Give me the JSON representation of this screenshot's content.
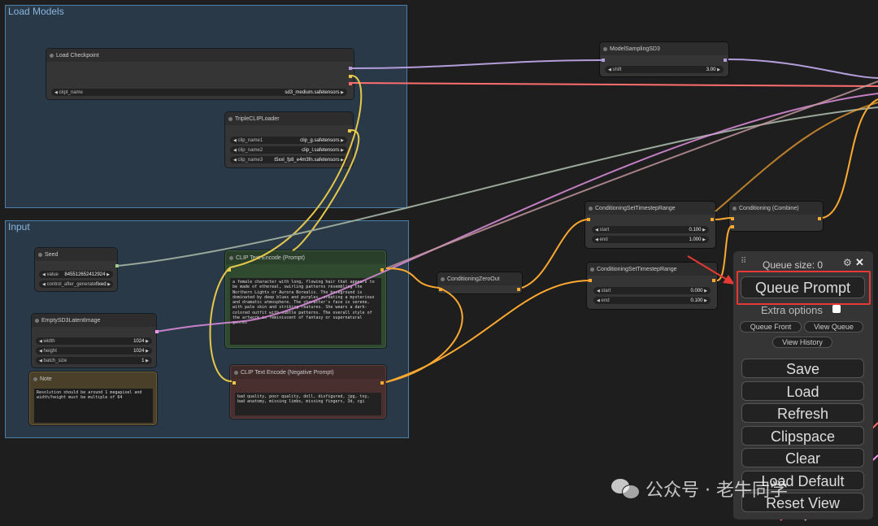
{
  "groups": {
    "load_models": "Load Models",
    "input": "Input"
  },
  "load_checkpoint": {
    "title": "Load Checkpoint",
    "ckpt_label": "ckpt_name",
    "ckpt_value": "sd3_medium.safetensors"
  },
  "model_sampling": {
    "title": "ModelSamplingSD3",
    "shift_label": "shift",
    "shift_value": "3.00"
  },
  "triple_clip": {
    "title": "TripleCLIPLoader",
    "clip1_label": "clip_name1",
    "clip1_value": "clip_g.safetensors",
    "clip2_label": "clip_name2",
    "clip2_value": "clip_l.safetensors",
    "clip3_label": "clip_name3",
    "clip3_value": "t5xxl_fp8_e4m3fn.safetensors"
  },
  "seed": {
    "title": "Seed",
    "value_label": "value",
    "value": "845512652412924",
    "control_label": "control_after_generate",
    "control_value": "fixed"
  },
  "latent": {
    "title": "EmptySD3LatentImage",
    "width_label": "width",
    "width_value": "1024",
    "height_label": "height",
    "height_value": "1024",
    "batch_label": "batch_size",
    "batch_value": "1"
  },
  "note": {
    "title": "Note",
    "text": "Resolution should be around 1 megapixel and width/height must be multiple of 64"
  },
  "clip_pos": {
    "title": "CLIP Text Encode (Prompt)",
    "text": "a female character with long, flowing hair that appears to be made of ethereal, swirling patterns resembling the Northern Lights or Aurora Borealis. The background is dominated by deep blues and purples, creating a mysterious and dramatic atmosphere. The character's face is serene, with pale skin and striking features. She wears a dark-colored outfit with subtle patterns. The overall style of the artwork is reminiscent of fantasy or supernatural genres"
  },
  "clip_neg": {
    "title": "CLIP Text Encode (Negative Prompt)",
    "text": "bad quality, poor quality, doll, disfigured, jpg, toy, bad anatomy, missing limbs, missing fingers, 3d, cgi"
  },
  "zero_out": {
    "title": "ConditioningZeroOut"
  },
  "timestep1": {
    "title": "ConditioningSetTimestepRange",
    "start_label": "start",
    "start_value": "0.100",
    "end_label": "end",
    "end_value": "1.000"
  },
  "timestep2": {
    "title": "ConditioningSetTimestepRange",
    "start_label": "start",
    "start_value": "0.000",
    "end_label": "end",
    "end_value": "0.100"
  },
  "combine": {
    "title": "Conditioning (Combine)"
  },
  "panel": {
    "queue_size": "Queue size: 0",
    "queue_prompt": "Queue Prompt",
    "extra_options": "Extra options",
    "queue_front": "Queue Front",
    "view_queue": "View Queue",
    "view_history": "View History",
    "save": "Save",
    "load": "Load",
    "refresh": "Refresh",
    "clipspace": "Clipspace",
    "clear": "Clear",
    "load_default": "Load Default",
    "reset_view": "Reset View"
  },
  "watermark": {
    "text": "公众号 · 老牛同学"
  },
  "colors": {
    "model": "#b39ddb",
    "clip": "#e6c84b",
    "vae": "#ff6e6e",
    "conditioning": "#ffa931",
    "latent": "#ff9cf9",
    "int": "#9fcf8a",
    "highlight": "#e53935"
  }
}
